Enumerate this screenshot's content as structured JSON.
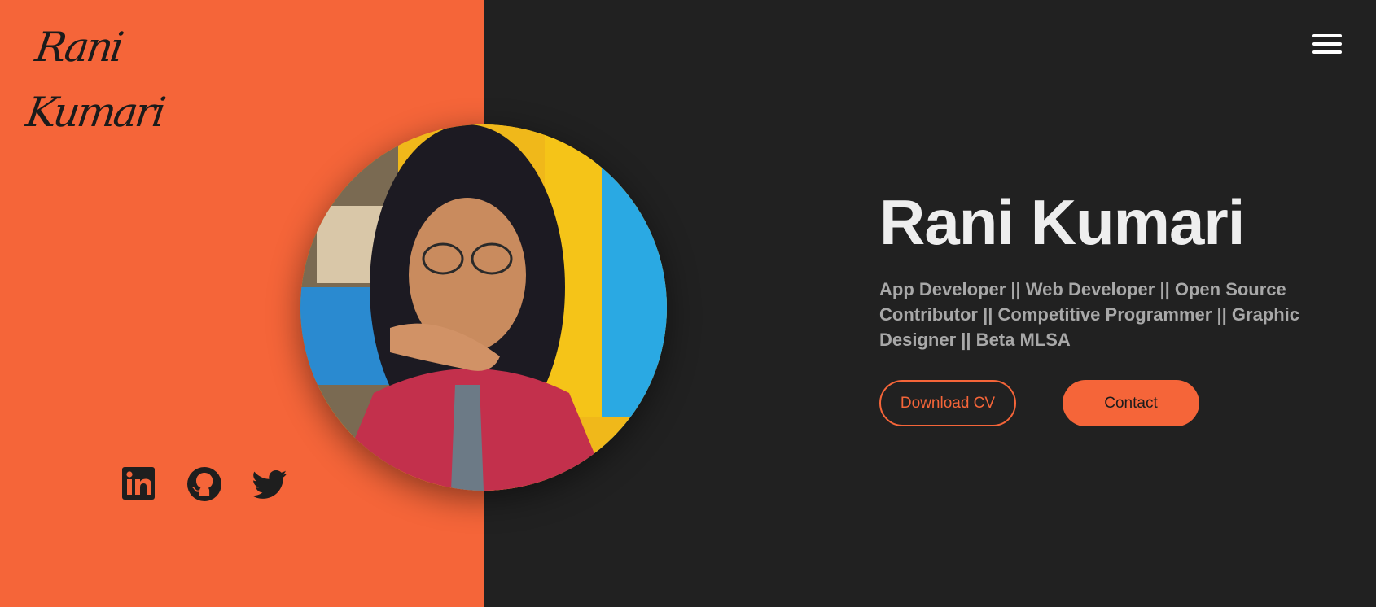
{
  "brand": {
    "logo_text": "Rani Kumari"
  },
  "nav": {
    "menu_icon": "hamburger-menu-icon"
  },
  "hero": {
    "name": "Rani Kumari",
    "description": "App Developer || Web Developer || Open Source Contributor || Competitive Programmer || Graphic Designer || Beta MLSA",
    "download_cv_label": "Download CV",
    "contact_label": "Contact"
  },
  "socials": [
    {
      "icon": "linkedin-icon"
    },
    {
      "icon": "github-icon"
    },
    {
      "icon": "twitter-icon"
    }
  ],
  "colors": {
    "accent": "#f56539",
    "dark_background": "#212121",
    "heading_text": "#eeeeee",
    "body_text": "#a8a8a8"
  }
}
